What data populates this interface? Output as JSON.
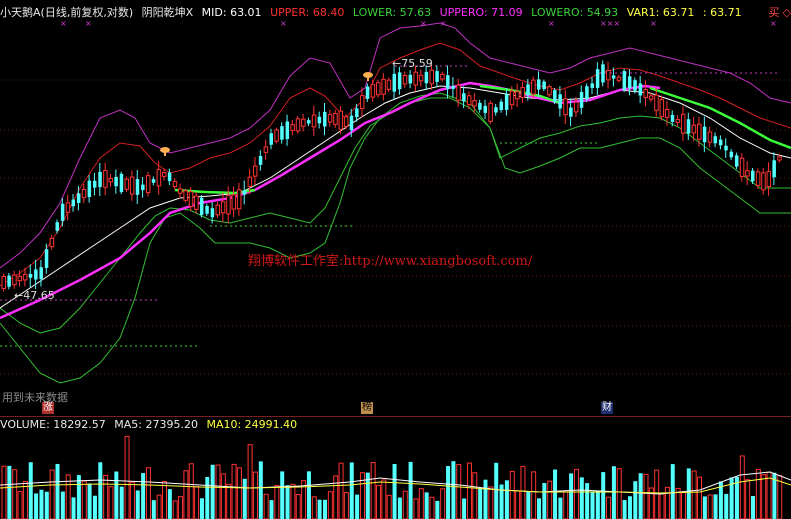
{
  "indicator_header": {
    "stock_name": "小天鹅A",
    "period_info": "(日线,前复权,对数)",
    "indicator_name": "阴阳乾坤X",
    "mid": "MID: 63.01",
    "upper": "UPPER: 68.40",
    "lower": "LOWER: 57.63",
    "uppero": "UPPERO: 71.09",
    "lowero": "LOWERO: 54.93",
    "var1": "VAR1: 63.71",
    "extra": ": 63.71",
    "buy": "买",
    "buy_diamond": "◇"
  },
  "annotations": {
    "high_label": "←75.59",
    "low_label": "←47.65",
    "watermark": "翔博软件工作室:http://www.xiangbosoft.com/",
    "future_note": "用到未来数据",
    "badge_zhang": "涨",
    "badge_bang": "榜",
    "badge_cai": "财"
  },
  "volume_header": {
    "volume": "VOLUME: 18292.57",
    "ma5": "MA5: 27395.20",
    "ma10": "MA10: 24991.40"
  },
  "colors": {
    "up_candle": "#ff3232",
    "down_candle": "#54ffff",
    "mid_line": "#ffffff",
    "var1_line": "#ff30ff",
    "trend_green": "#3cff3c",
    "upper_band": "#ff3030",
    "lower_band": "#34c034",
    "outer_band": "#c030c0",
    "ma10_label": "#ffff40"
  }
}
